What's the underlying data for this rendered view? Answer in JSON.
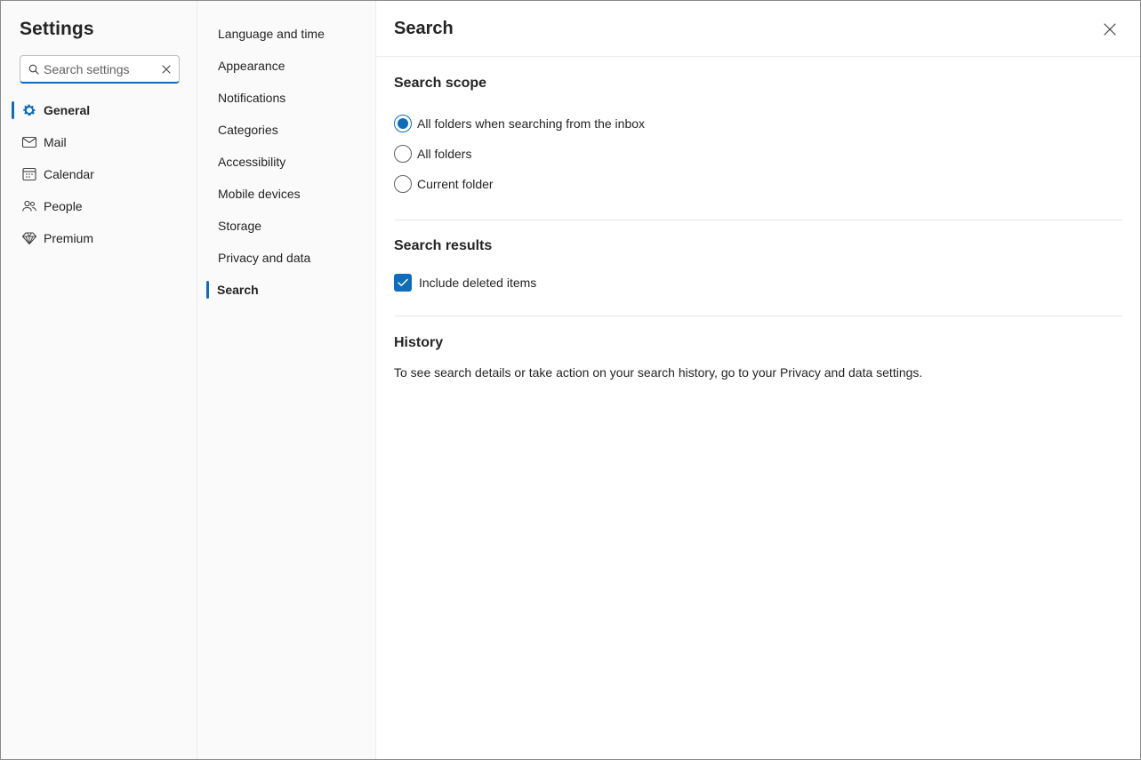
{
  "sidebar": {
    "title": "Settings",
    "search_placeholder": "Search settings",
    "items": [
      {
        "label": "General",
        "icon": "gear-icon"
      },
      {
        "label": "Mail",
        "icon": "mail-icon"
      },
      {
        "label": "Calendar",
        "icon": "calendar-icon"
      },
      {
        "label": "People",
        "icon": "people-icon"
      },
      {
        "label": "Premium",
        "icon": "diamond-icon"
      }
    ],
    "active": "General"
  },
  "subnav": {
    "items": [
      {
        "label": "Language and time"
      },
      {
        "label": "Appearance"
      },
      {
        "label": "Notifications"
      },
      {
        "label": "Categories"
      },
      {
        "label": "Accessibility"
      },
      {
        "label": "Mobile devices"
      },
      {
        "label": "Storage"
      },
      {
        "label": "Privacy and data"
      },
      {
        "label": "Search"
      }
    ],
    "active": "Search"
  },
  "page": {
    "title": "Search",
    "search_scope": {
      "title": "Search scope",
      "options": [
        {
          "label": "All folders when searching from the inbox",
          "checked": true
        },
        {
          "label": "All folders",
          "checked": false
        },
        {
          "label": "Current folder",
          "checked": false
        }
      ]
    },
    "search_results": {
      "title": "Search results",
      "include_deleted_label": "Include deleted items",
      "include_deleted_checked": true
    },
    "history": {
      "title": "History",
      "text": "To see search details or take action on your search history, go to your Privacy and data settings."
    }
  },
  "colors": {
    "accent": "#0f6cbd",
    "pane_bg": "#fafafa"
  }
}
